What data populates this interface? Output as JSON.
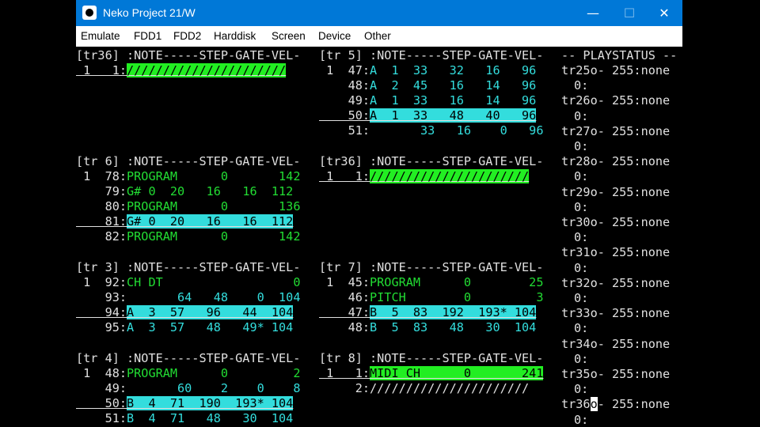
{
  "window": {
    "title": "Neko Project 21/W",
    "minimize": "—",
    "maximize": "☐",
    "close": "✕"
  },
  "menu": [
    "Emulate",
    "FDD1",
    "FDD2",
    "Harddisk",
    "Screen",
    "Device",
    "Other"
  ],
  "screen": {
    "col1": {
      "block1": {
        "header": "[tr36] :NOTE-----STEP-GATE-VEL-",
        "row1_num": " 1   1:",
        "row1_bar": "//////////////////////"
      },
      "block2": {
        "header": "[tr 6] :NOTE-----STEP-GATE-VEL-",
        "rows": [
          {
            "num": " 1  78:",
            "data": "PROGRAM      0       142",
            "style": "g"
          },
          {
            "num": "    79:",
            "data": "G# 0  20   16   16  112",
            "style": "g"
          },
          {
            "num": "    80:",
            "data": "PROGRAM      0       136",
            "style": "g"
          },
          {
            "num": "    81:",
            "data": "G# 0  20   16   16  112",
            "style": "cbar"
          },
          {
            "num": "    82:",
            "data": "PROGRAM      0       142",
            "style": "g"
          }
        ]
      },
      "block3": {
        "header": "[tr 3] :NOTE-----STEP-GATE-VEL-",
        "rows": [
          {
            "num": " 1  92:",
            "data": "CH DT                  0",
            "style": "g"
          },
          {
            "num": "    93:",
            "data": "       64   48    0  104",
            "style": "c"
          },
          {
            "num": "    94:",
            "data": "A  3  57   96   44  104",
            "style": "cbar"
          },
          {
            "num": "    95:",
            "data": "A  3  57   48   49* 104",
            "style": "c"
          }
        ]
      },
      "block4": {
        "header": "[tr 4] :NOTE-----STEP-GATE-VEL-",
        "rows": [
          {
            "num": " 1  48:",
            "data": "PROGRAM      0         2",
            "style": "g"
          },
          {
            "num": "    49:",
            "data": "       60    2    0    8",
            "style": "c"
          },
          {
            "num": "    50:",
            "data": "B  4  71  190  193* 104",
            "style": "cbar"
          },
          {
            "num": "    51:",
            "data": "B  4  71   48   30  104",
            "style": "c"
          }
        ]
      }
    },
    "col2": {
      "block1": {
        "header": "[tr 5] :NOTE-----STEP-GATE-VEL-",
        "rows": [
          {
            "num": " 1  47:",
            "data": "A  1  33   32   16   96",
            "style": "c"
          },
          {
            "num": "    48:",
            "data": "A  2  45   16   14   96",
            "style": "c"
          },
          {
            "num": "    49:",
            "data": "A  1  33   16   14   96",
            "style": "c"
          },
          {
            "num": "    50:",
            "data": "A  1  33   48   40   96",
            "style": "cbar"
          },
          {
            "num": "    51:",
            "data": "       33   16    0   96",
            "style": "c"
          }
        ]
      },
      "block2": {
        "header": "[tr36] :NOTE-----STEP-GATE-VEL-",
        "row1_num": " 1   1:",
        "row1_bar": "//////////////////////"
      },
      "block3": {
        "header": "[tr 7] :NOTE-----STEP-GATE-VEL-",
        "rows": [
          {
            "num": " 1  45:",
            "data": "PROGRAM      0        25",
            "style": "g"
          },
          {
            "num": "    46:",
            "data": "PITCH        0         3",
            "style": "g"
          },
          {
            "num": "    47:",
            "data": "B  5  83  192  193* 104",
            "style": "cbar"
          },
          {
            "num": "    48:",
            "data": "B  5  83   48   30  104",
            "style": "c"
          }
        ]
      },
      "block4": {
        "header": "[tr 8] :NOTE-----STEP-GATE-VEL-",
        "row1_num": " 1   1:",
        "row1_bar": "MIDI CH      0       241",
        "row2_num": "     2:",
        "row2_bar": "//////////////////////"
      }
    },
    "col3": {
      "header": "-- PLAYSTATUS --",
      "lines": [
        "tr25o- 255:none",
        "0:",
        "tr26o- 255:none",
        "0:",
        "tr27o- 255:none",
        "0:",
        "tr28o- 255:none",
        "0:",
        "tr29o- 255:none",
        "0:",
        "tr30o- 255:none",
        "0:",
        "tr31o- 255:none",
        "0:",
        "tr32o- 255:none",
        "0:",
        "tr33o- 255:none",
        "0:",
        "tr34o- 255:none",
        "0:",
        "tr35o- 255:none",
        "0:",
        "tr36o- 255:none",
        "0:"
      ],
      "cursor_line_prefix": "tr36",
      "cursor_char": "o",
      "cursor_line_suffix": "- 255:none"
    }
  }
}
